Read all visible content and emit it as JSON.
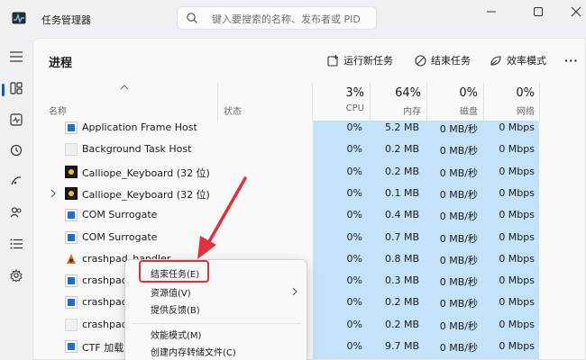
{
  "window": {
    "title": "任务管理器",
    "search_placeholder": "键入要搜索的名称、发布者或 PID"
  },
  "nav": {
    "items": [
      "hamburger-menu",
      "processes",
      "performance",
      "app-history",
      "startup-apps",
      "users",
      "details",
      "services"
    ],
    "active": "processes"
  },
  "toolbar": {
    "section_title": "进程",
    "run_new_task": "运行新任务",
    "end_task": "结束任务",
    "efficiency_mode": "效率模式",
    "more": "···"
  },
  "columns": {
    "name": "名称",
    "status": "状态",
    "cpu": {
      "pct": "3%",
      "label": "CPU"
    },
    "memory": {
      "pct": "64%",
      "label": "内存"
    },
    "disk": {
      "pct": "0%",
      "label": "磁盘"
    },
    "network": {
      "pct": "0%",
      "label": "网络"
    }
  },
  "rows": [
    {
      "name": "Application Frame Host",
      "icon": "window-icon",
      "expandable": false,
      "cpu": "0%",
      "memory": "5.2 MB",
      "disk": "0 MB/秒",
      "network": "0 Mbps"
    },
    {
      "name": "Background Task Host",
      "icon": "blank-icon",
      "expandable": false,
      "cpu": "0%",
      "memory": "0.2 MB",
      "disk": "0 MB/秒",
      "network": "0 Mbps"
    },
    {
      "name": "Calliope_Keyboard (32 位)",
      "icon": "keyboard-app-icon",
      "expandable": false,
      "cpu": "0%",
      "memory": "0.2 MB",
      "disk": "0 MB/秒",
      "network": "0 Mbps"
    },
    {
      "name": "Calliope_Keyboard (32 位)",
      "icon": "keyboard-app-icon",
      "expandable": true,
      "cpu": "0%",
      "memory": "0.1 MB",
      "disk": "0 MB/秒",
      "network": "0 Mbps"
    },
    {
      "name": "COM Surrogate",
      "icon": "window-icon",
      "expandable": false,
      "cpu": "0%",
      "memory": "0.4 MB",
      "disk": "0 MB/秒",
      "network": "0 Mbps"
    },
    {
      "name": "COM Surrogate",
      "icon": "window-icon",
      "expandable": false,
      "cpu": "0%",
      "memory": "0.7 MB",
      "disk": "0 MB/秒",
      "network": "0 Mbps"
    },
    {
      "name": "crashpad_handler",
      "icon": "crashpad-icon",
      "expandable": false,
      "cpu": "0%",
      "memory": "0.8 MB",
      "disk": "0 MB/秒",
      "network": "0 Mbps"
    },
    {
      "name": "crashpad",
      "icon": "window-icon",
      "expandable": false,
      "cpu": "0%",
      "memory": "0.3 MB",
      "disk": "0 MB/秒",
      "network": "0 Mbps"
    },
    {
      "name": "crashpad",
      "icon": "window-icon",
      "expandable": false,
      "cpu": "0%",
      "memory": "0.2 MB",
      "disk": "0 MB/秒",
      "network": "0 Mbps"
    },
    {
      "name": "crashpad",
      "icon": "blank-icon",
      "expandable": false,
      "cpu": "0%",
      "memory": "0.2 MB",
      "disk": "0 MB/秒",
      "network": "0 Mbps"
    },
    {
      "name": "CTF 加载",
      "icon": "window-icon",
      "expandable": false,
      "cpu": "0%",
      "memory": "9.7 MB",
      "disk": "0 MB/秒",
      "network": "0 Mbps"
    }
  ],
  "context_menu": {
    "end_task": "结束任务(E)",
    "resource_values": "资源值(V)",
    "feedback": "提供反馈(B)",
    "efficiency_mode": "效能模式(M)",
    "create_dump": "创建内存转储文件(C)"
  }
}
